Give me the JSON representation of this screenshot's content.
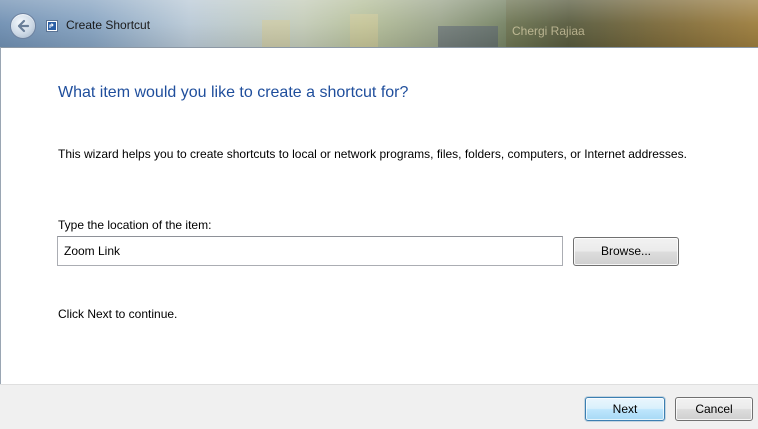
{
  "window": {
    "title": "Create Shortcut",
    "background_text": "Chergi Rajiaa"
  },
  "colors": {
    "heading": "#1f4e9c",
    "footer_bg": "#f0f0f0",
    "default_button_border": "#3c7fb1"
  },
  "icons": {
    "back": "back-arrow-icon",
    "app": "shortcut-app-icon"
  },
  "content": {
    "heading": "What item would you like to create a shortcut for?",
    "description": "This wizard helps you to create shortcuts to local or network programs, files, folders, computers, or Internet addresses.",
    "location_label": "Type the location of the item:",
    "location_value": "Zoom Link",
    "browse_label": "Browse...",
    "continue_text": "Click Next to continue."
  },
  "footer": {
    "next_label": "Next",
    "cancel_label": "Cancel"
  }
}
